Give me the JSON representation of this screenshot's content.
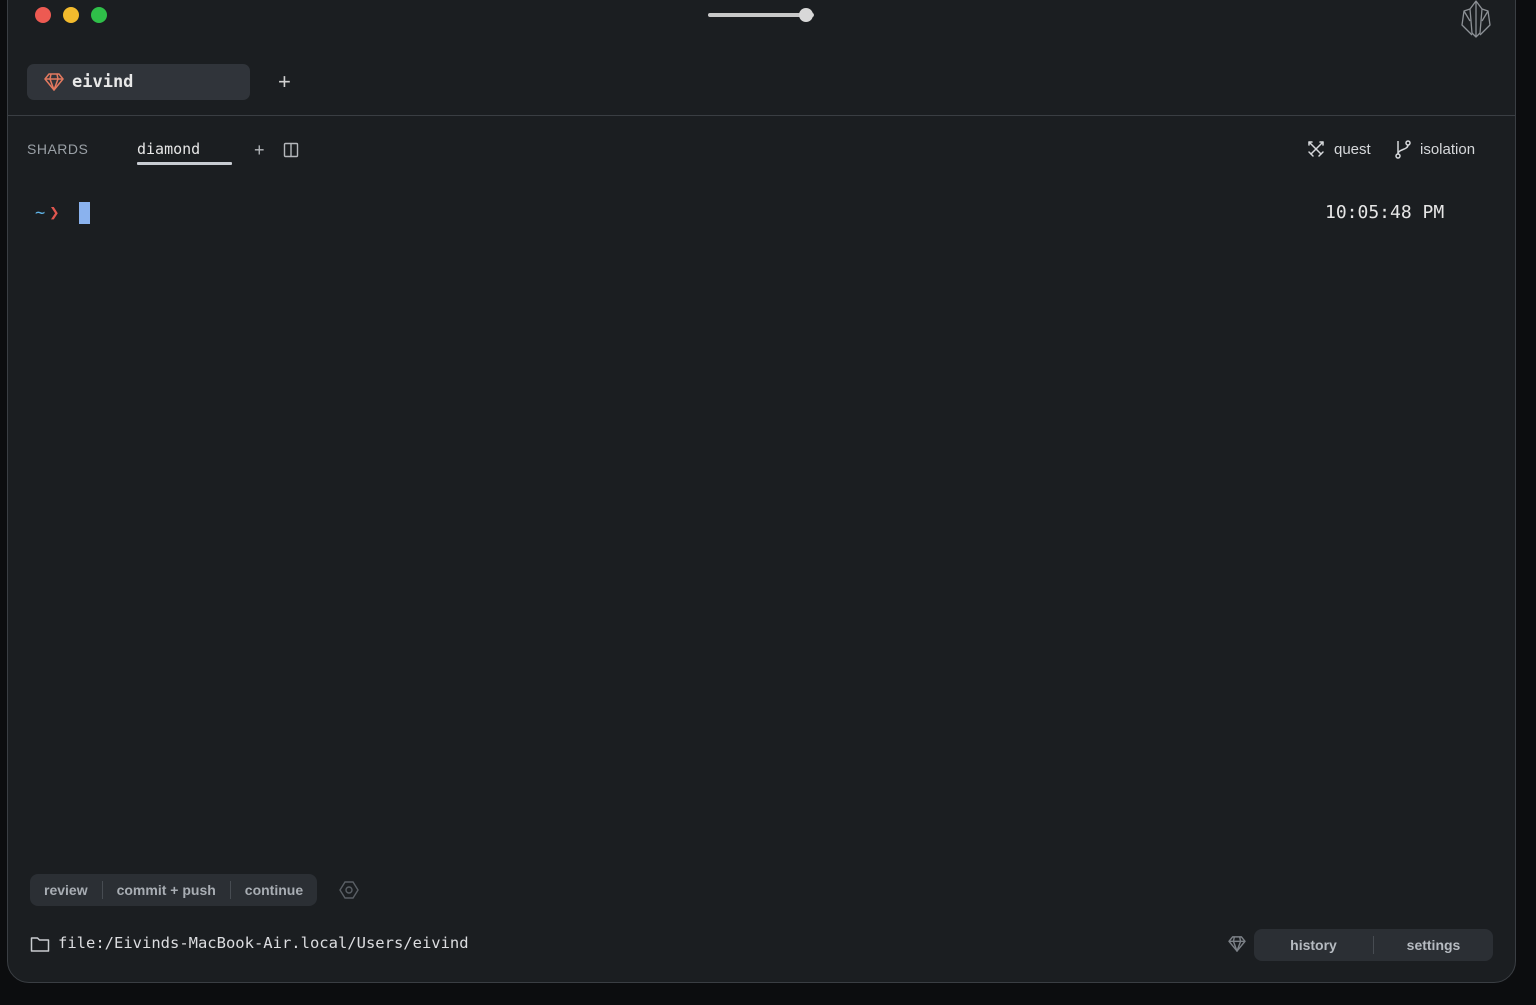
{
  "window": {
    "zoom_level": 0.92
  },
  "workspace_tabs": [
    {
      "label": "eivind",
      "icon": "diamond-icon",
      "accent": "#e3795f"
    }
  ],
  "shards": {
    "section_label": "SHARDS",
    "tabs": [
      {
        "label": "diamond",
        "active": true
      }
    ],
    "right_buttons": [
      {
        "label": "quest",
        "icon": "swords-icon"
      },
      {
        "label": "isolation",
        "icon": "git-branch-icon"
      }
    ]
  },
  "terminal": {
    "cwd_symbol": "~",
    "prompt_symbol": "❯",
    "timestamp": "10:05:48 PM"
  },
  "actions": [
    "review",
    "commit + push",
    "continue"
  ],
  "footer": {
    "path": "file:/Eivinds-MacBook-Air.local/Users/eivind",
    "buttons": [
      "history",
      "settings"
    ]
  }
}
